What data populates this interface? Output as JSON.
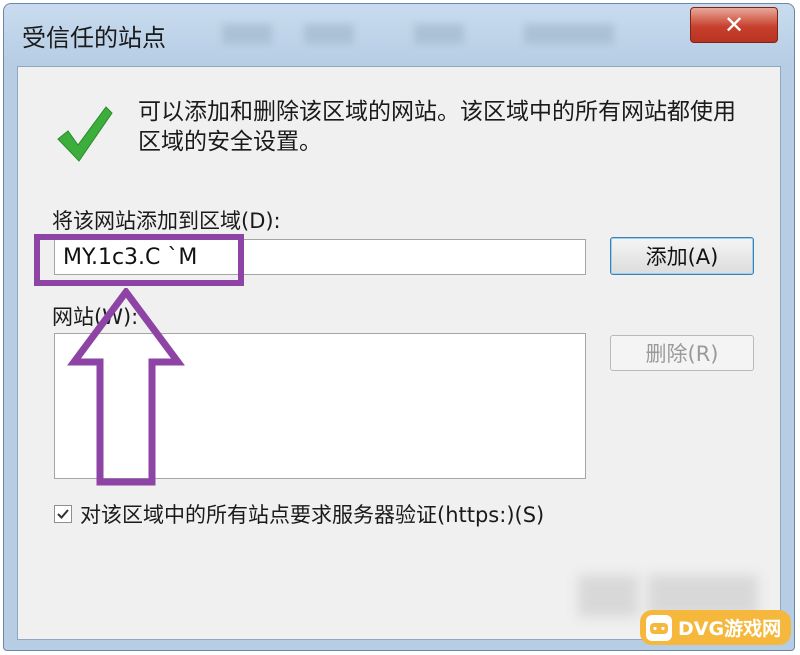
{
  "window": {
    "title": "受信任的站点",
    "close_label": "✕"
  },
  "dialog": {
    "description": "可以添加和删除该区域的网站。该区域中的所有网站都使用区域的安全设置。",
    "add_label": "将该网站添加到区域(D):",
    "url_value": "MY.1c3.C `M",
    "add_button": "添加(A)",
    "sites_label": "网站(W):",
    "sites": [],
    "remove_button": "删除(R)",
    "https_label": "对该区域中的所有站点要求服务器验证(https:)(S)",
    "https_checked": true
  },
  "watermark": {
    "text": "DVG游戏网"
  },
  "colors": {
    "highlight": "#8e44a5",
    "check_green": "#3cae3c",
    "close_red": "#c7402d"
  },
  "icons": {
    "status": "green-check-icon",
    "close": "close-icon",
    "annotation": "up-arrow-icon"
  }
}
